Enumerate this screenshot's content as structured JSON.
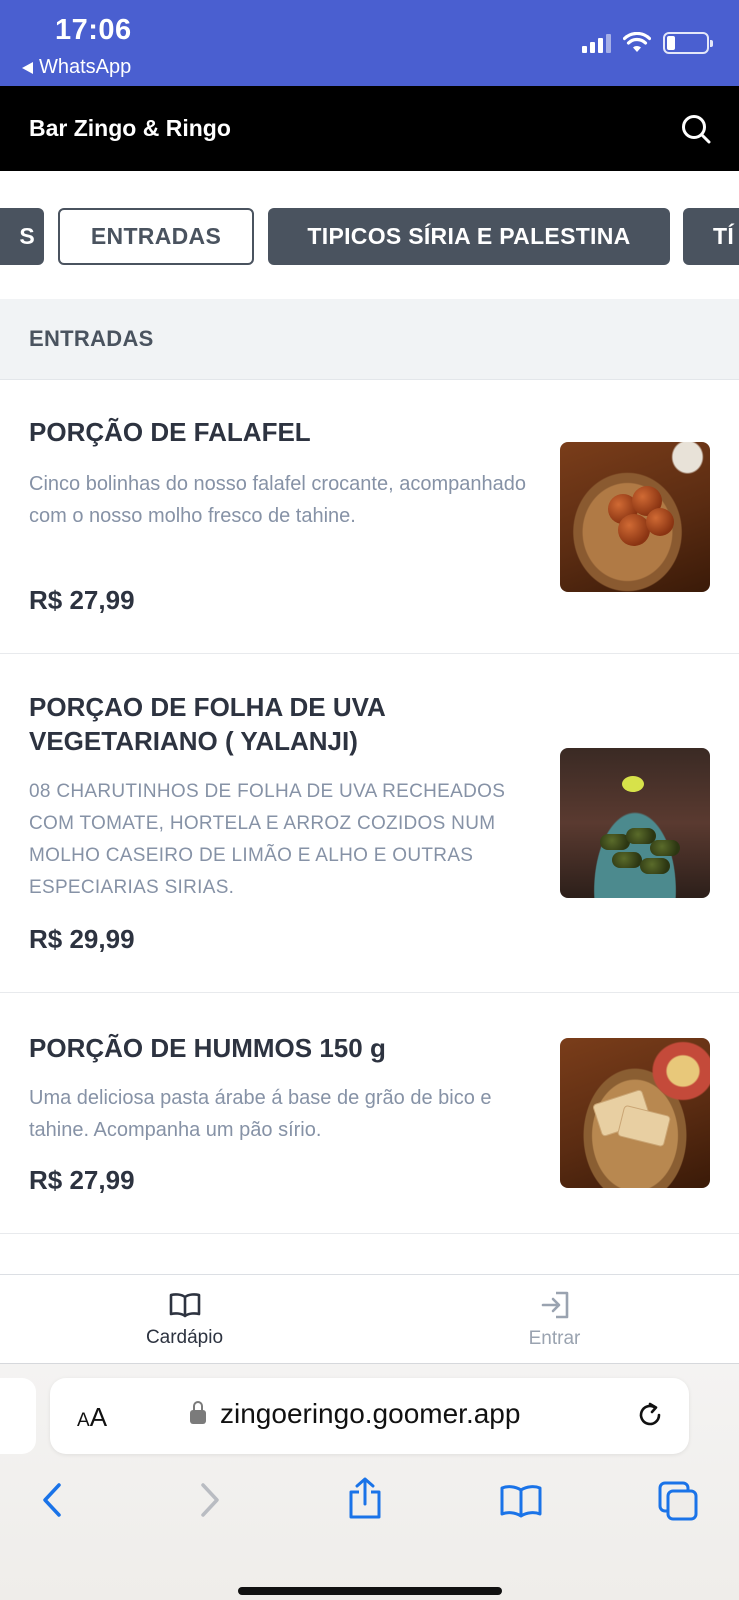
{
  "status_bar": {
    "time": "17:06",
    "back_app": "WhatsApp",
    "battery_level": 0.2
  },
  "header": {
    "title": "Bar Zingo & Ringo",
    "search_icon": "search-icon"
  },
  "categories": [
    {
      "label": "S",
      "active": false
    },
    {
      "label": "ENTRADAS",
      "active": true
    },
    {
      "label": "TIPICOS SÍRIA E PALESTINA",
      "active": false
    },
    {
      "label": "TÍ",
      "active": false
    }
  ],
  "section": {
    "title": "ENTRADAS"
  },
  "items": [
    {
      "name": "PORÇÃO DE FALAFEL",
      "description": "Cinco bolinhas do nosso falafel crocante, acompanhado com o nosso molho fresco de tahine.",
      "price": "R$ 27,99"
    },
    {
      "name": "PORÇAO DE FOLHA DE UVA VEGETARIANO ( YALANJI)",
      "description": "08 CHARUTINHOS DE FOLHA DE UVA RECHEADOS COM TOMATE, HORTELA E ARROZ COZIDOS NUM MOLHO CASEIRO DE LIMÃO E ALHO E OUTRAS ESPECIARIAS SIRIAS.",
      "price": "R$ 29,99"
    },
    {
      "name": "PORÇÃO DE HUMMOS 150 g",
      "description": "Uma deliciosa pasta árabe á base de grão de bico e tahine. Acompanha um pão sírio.",
      "price": "R$ 27,99"
    }
  ],
  "bottom_nav": {
    "menu_label": "Cardápio",
    "login_label": "Entrar"
  },
  "browser": {
    "text_size_label": "AA",
    "url": "zingoeringo.goomer.app"
  },
  "colors": {
    "status_bar": "#4a5fd0",
    "header": "#000000",
    "category_dark": "#4a535f",
    "description_text": "#8692a6",
    "browser_accent": "#1a73e8"
  }
}
